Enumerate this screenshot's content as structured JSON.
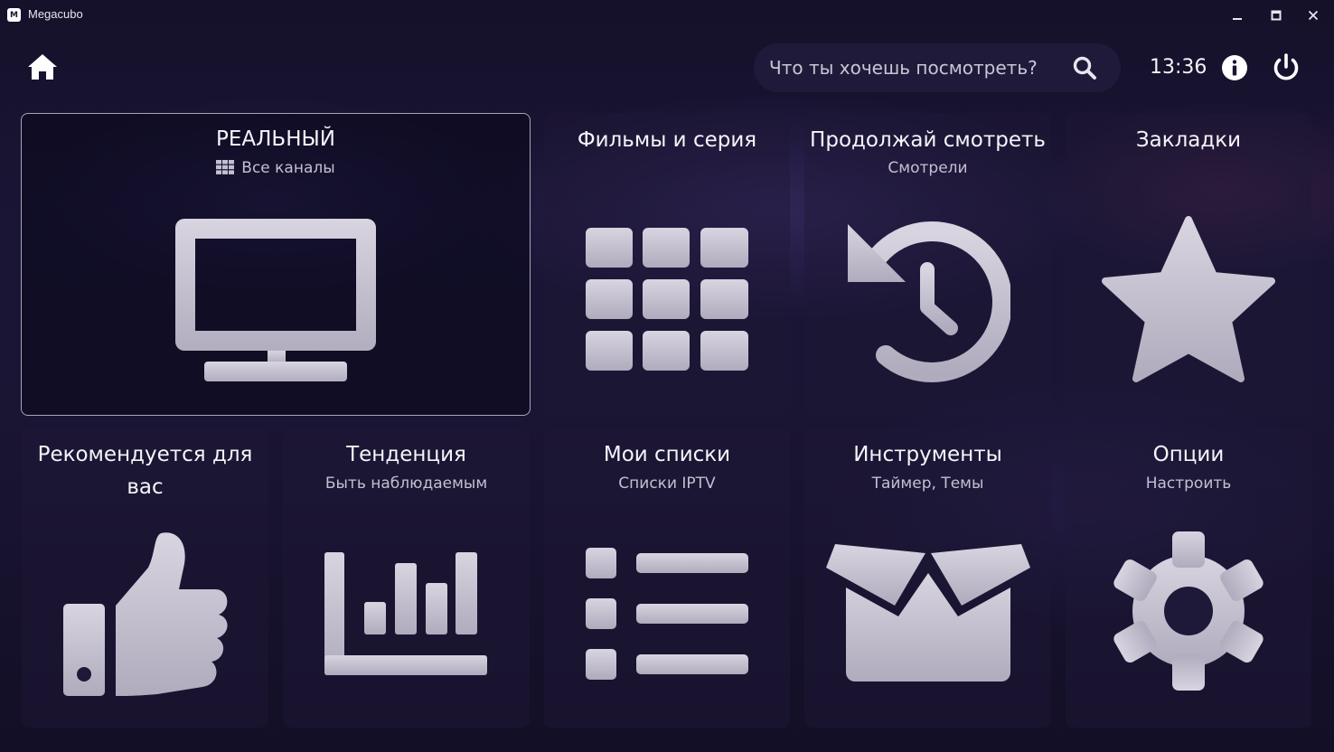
{
  "window": {
    "title": "Megacubo",
    "logo_letter": "M"
  },
  "topbar": {
    "search_placeholder": "Что ты хочешь посмотреть?",
    "clock": "13:36"
  },
  "tiles": [
    {
      "title": "РЕАЛЬНЫЙ",
      "subtitle": "Все каналы",
      "icon": "tv-icon",
      "selected": true
    },
    {
      "title": "Фильмы и серия",
      "subtitle": "",
      "icon": "grid-icon"
    },
    {
      "title": "Продолжай смотреть",
      "subtitle": "Смотрели",
      "icon": "history-icon"
    },
    {
      "title": "Закладки",
      "subtitle": "",
      "icon": "star-icon"
    },
    {
      "title": "Рекомендуется для вас",
      "subtitle": "",
      "icon": "thumbs-up-icon"
    },
    {
      "title": "Тенденция",
      "subtitle": "Быть наблюдаемым",
      "icon": "bar-chart-icon"
    },
    {
      "title": "Мои списки",
      "subtitle": "Списки IPTV",
      "icon": "list-icon"
    },
    {
      "title": "Инструменты",
      "subtitle": "Таймер, Темы",
      "icon": "box-open-icon"
    },
    {
      "title": "Опции",
      "subtitle": "Настроить",
      "icon": "gear-icon"
    }
  ],
  "colors": {
    "icon_fill": "#c8c4d2",
    "background": "#1a1535"
  }
}
